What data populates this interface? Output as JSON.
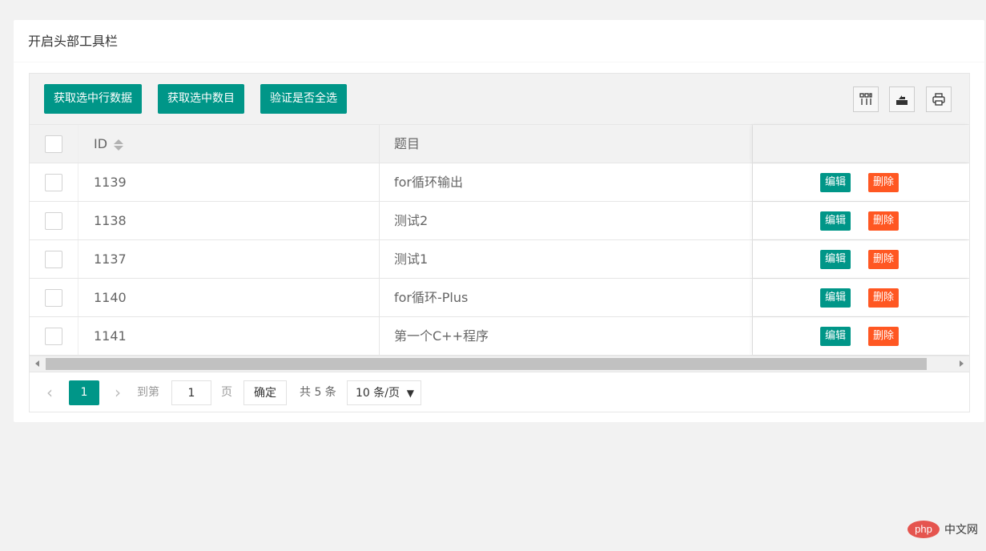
{
  "card": {
    "title": "开启头部工具栏"
  },
  "toolbar": {
    "buttons": [
      "获取选中行数据",
      "获取选中数目",
      "验证是否全选"
    ],
    "icons": [
      "columns-icon",
      "export-icon",
      "print-icon"
    ]
  },
  "table": {
    "columns": {
      "id": "ID",
      "title": "题目",
      "ops": ""
    },
    "rows": [
      {
        "id": "1139",
        "title": "for循环输出"
      },
      {
        "id": "1138",
        "title": "测试2"
      },
      {
        "id": "1137",
        "title": "测试1"
      },
      {
        "id": "1140",
        "title": "for循环-Plus"
      },
      {
        "id": "1141",
        "title": "第一个C++程序"
      }
    ],
    "edit_label": "编辑",
    "delete_label": "删除"
  },
  "pager": {
    "prev": "‹",
    "current": "1",
    "next": "›",
    "goto_label": "到第",
    "goto_value": "1",
    "page_unit": "页",
    "confirm": "确定",
    "total": "共 5 条",
    "page_size": "10 条/页"
  },
  "watermark": {
    "logo": "php",
    "text": "中文网"
  },
  "colors": {
    "primary": "#009688",
    "danger": "#ff5722"
  }
}
